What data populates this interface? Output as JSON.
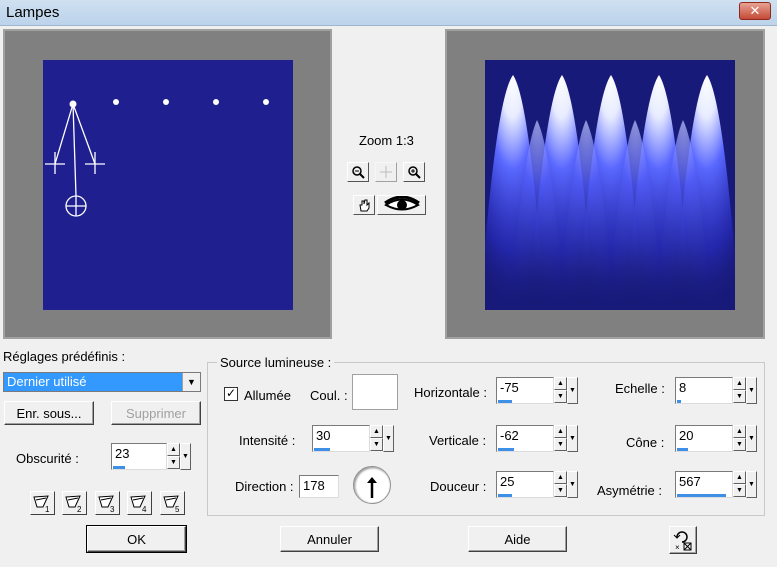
{
  "window": {
    "title": "Lampes",
    "close_glyph": "✕"
  },
  "preview": {
    "zoom_label": "Zoom 1:3"
  },
  "presets": {
    "label": "Réglages prédéfinis :",
    "selected": "Dernier utilisé",
    "save_label": "Enr. sous...",
    "delete_label": "Supprimer"
  },
  "obscurite": {
    "label": "Obscurité :",
    "value": "23",
    "level": 0.23
  },
  "source": {
    "title": "Source lumineuse :",
    "allumee": {
      "label": "Allumée",
      "checked": true
    },
    "couleur": {
      "label": "Coul. :",
      "value": "#ffffff"
    },
    "intensite": {
      "label": "Intensité :",
      "value": "30",
      "level": 0.3
    },
    "direction": {
      "label": "Direction :",
      "value": "178"
    },
    "horizontale": {
      "label": "Horizontale :",
      "value": "-75",
      "level": 0.25
    },
    "verticale": {
      "label": "Verticale :",
      "value": "-62",
      "level": 0.3
    },
    "douceur": {
      "label": "Douceur :",
      "value": "25",
      "level": 0.25
    },
    "echelle": {
      "label": "Echelle :",
      "value": "8",
      "level": 0.08
    },
    "cone": {
      "label": "Cône :",
      "value": "20",
      "level": 0.2
    },
    "asymetrie": {
      "label": "Asymétrie :",
      "value": "567",
      "level": 0.9
    }
  },
  "lamp_presets": [
    "1",
    "2",
    "3",
    "4",
    "5"
  ],
  "buttons": {
    "ok": "OK",
    "cancel": "Annuler",
    "help": "Aide"
  },
  "colors": {
    "preview_bg": "#1f1f8f",
    "slider_fill": "#3f8fe6",
    "selection": "#3399ff"
  }
}
